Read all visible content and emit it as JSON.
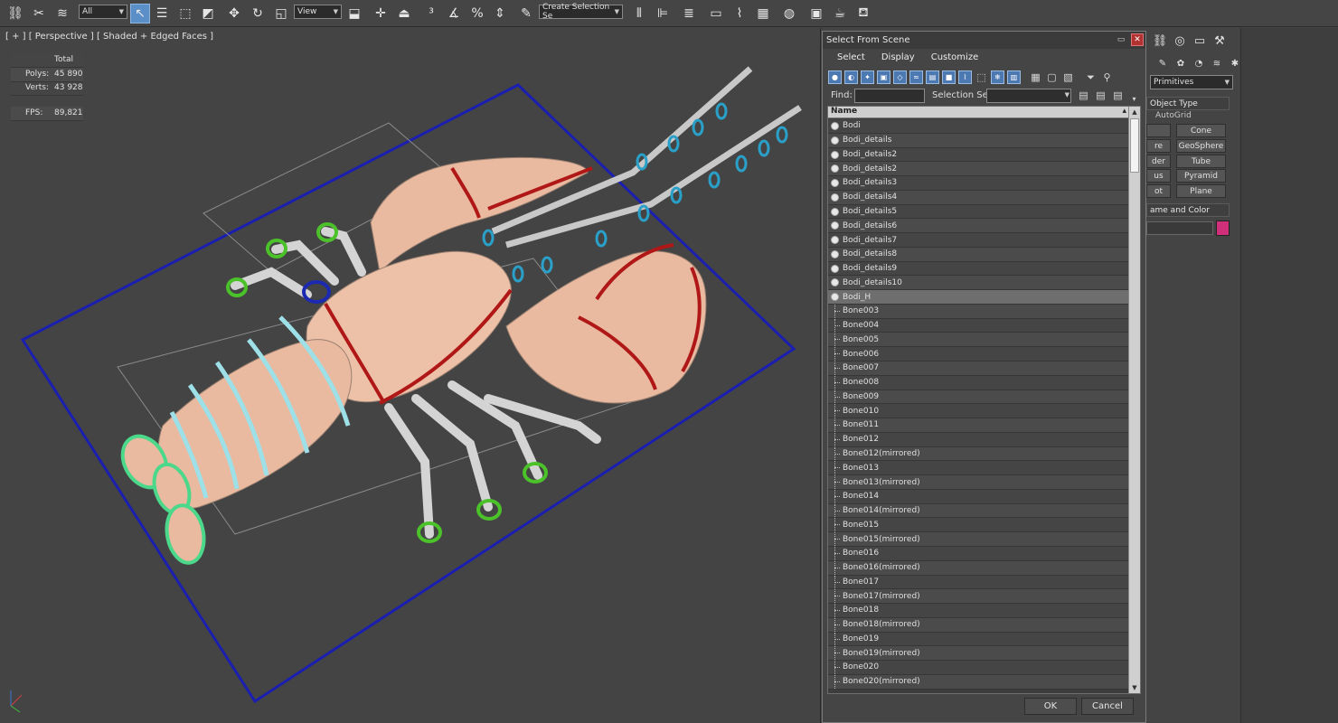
{
  "toolbar": {
    "filter_value": "All",
    "ref_coord_value": "View",
    "selection_set_value": "Create Selection Se"
  },
  "viewport": {
    "label": "[ + ] [ Perspective ] [ Shaded + Edged Faces ]",
    "stats_header": "Total",
    "polys_label": "Polys:",
    "polys_value": "45 890",
    "verts_label": "Verts:",
    "verts_value": "43 928",
    "fps_label": "FPS:",
    "fps_value": "89,821"
  },
  "dialog": {
    "title": "Select From Scene",
    "menu": [
      "Select",
      "Display",
      "Customize"
    ],
    "find_label": "Find:",
    "selection_set_label": "Selection Set:",
    "column_header": "Name",
    "items": [
      {
        "name": "Bodi",
        "type": "mesh"
      },
      {
        "name": "Bodi_details",
        "type": "mesh"
      },
      {
        "name": "Bodi_details2",
        "type": "mesh"
      },
      {
        "name": "Bodi_details2",
        "type": "mesh"
      },
      {
        "name": "Bodi_details3",
        "type": "mesh"
      },
      {
        "name": "Bodi_details4",
        "type": "mesh"
      },
      {
        "name": "Bodi_details5",
        "type": "mesh"
      },
      {
        "name": "Bodi_details6",
        "type": "mesh"
      },
      {
        "name": "Bodi_details7",
        "type": "mesh"
      },
      {
        "name": "Bodi_details8",
        "type": "mesh"
      },
      {
        "name": "Bodi_details9",
        "type": "mesh"
      },
      {
        "name": "Bodi_details10",
        "type": "mesh"
      },
      {
        "name": "Bodi_H",
        "type": "mesh"
      },
      {
        "name": "Bone003",
        "type": "bone"
      },
      {
        "name": "Bone004",
        "type": "bone"
      },
      {
        "name": "Bone005",
        "type": "bone"
      },
      {
        "name": "Bone006",
        "type": "bone"
      },
      {
        "name": "Bone007",
        "type": "bone"
      },
      {
        "name": "Bone008",
        "type": "bone"
      },
      {
        "name": "Bone009",
        "type": "bone"
      },
      {
        "name": "Bone010",
        "type": "bone"
      },
      {
        "name": "Bone011",
        "type": "bone"
      },
      {
        "name": "Bone012",
        "type": "bone"
      },
      {
        "name": "Bone012(mirrored)",
        "type": "bone"
      },
      {
        "name": "Bone013",
        "type": "bone"
      },
      {
        "name": "Bone013(mirrored)",
        "type": "bone"
      },
      {
        "name": "Bone014",
        "type": "bone"
      },
      {
        "name": "Bone014(mirrored)",
        "type": "bone"
      },
      {
        "name": "Bone015",
        "type": "bone"
      },
      {
        "name": "Bone015(mirrored)",
        "type": "bone"
      },
      {
        "name": "Bone016",
        "type": "bone"
      },
      {
        "name": "Bone016(mirrored)",
        "type": "bone"
      },
      {
        "name": "Bone017",
        "type": "bone"
      },
      {
        "name": "Bone017(mirrored)",
        "type": "bone"
      },
      {
        "name": "Bone018",
        "type": "bone"
      },
      {
        "name": "Bone018(mirrored)",
        "type": "bone"
      },
      {
        "name": "Bone019",
        "type": "bone"
      },
      {
        "name": "Bone019(mirrored)",
        "type": "bone"
      },
      {
        "name": "Bone020",
        "type": "bone"
      },
      {
        "name": "Bone020(mirrored)",
        "type": "bone"
      }
    ],
    "selected_item": "Bodi_H",
    "ok_label": "OK",
    "cancel_label": "Cancel"
  },
  "command_panel": {
    "category_value": "Primitives",
    "object_type_header": "Object Type",
    "autogrid_label": "AutoGrid",
    "buttons": [
      "Cone",
      "GeoSphere",
      "Tube",
      "Pyramid",
      "Plane"
    ],
    "partial_labels": [
      "re",
      "der",
      "us",
      "ot"
    ],
    "name_color_header": "ame and Color",
    "object_color": "#d0307a"
  }
}
